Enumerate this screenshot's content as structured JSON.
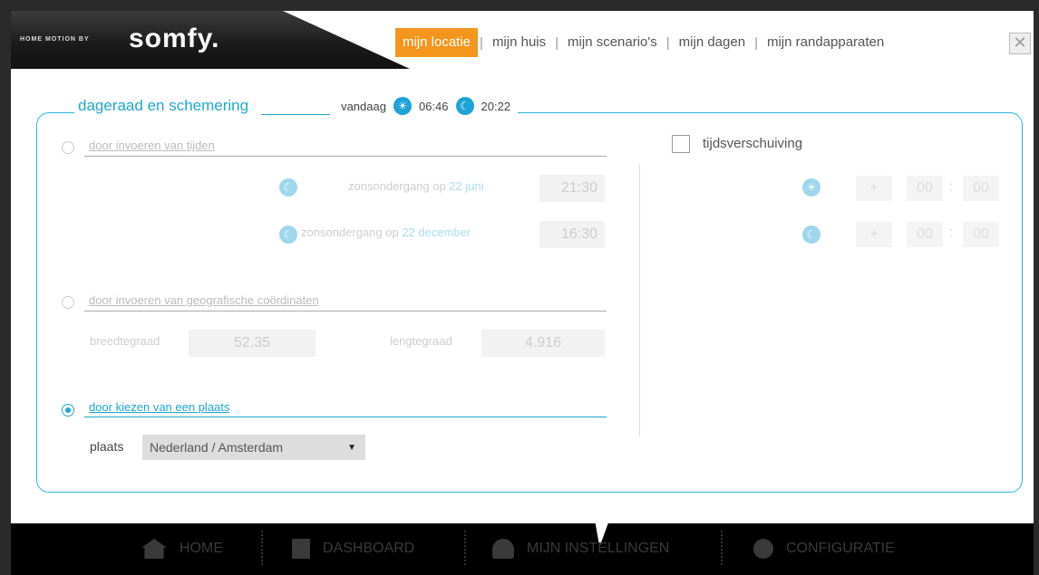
{
  "brand": {
    "small": "HOME MOTION BY",
    "logo": "somfy."
  },
  "tabs": [
    {
      "label": "mijn locatie",
      "active": true
    },
    {
      "label": "mijn huis"
    },
    {
      "label": "mijn scenario's"
    },
    {
      "label": "mijn dagen"
    },
    {
      "label": "mijn randapparaten"
    }
  ],
  "close_glyph": "✕",
  "section": {
    "title": "dageraad en schemering",
    "today_label": "vandaag",
    "sunrise_time": "06:46",
    "sunset_time": "20:22"
  },
  "options": {
    "times": {
      "label": "door invoeren van tijden",
      "row1_prefix": "zonsondergang op ",
      "row1_date": "22 juni",
      "row1_time": "21:30",
      "row2_prefix": "zonsondergang op ",
      "row2_date": "22 december",
      "row2_time": "16:30"
    },
    "coords": {
      "label": "door invoeren van geografische coördinaten",
      "lat_label": "breedtegraad",
      "lat_value": "52.35",
      "lon_label": "lengtegraad",
      "lon_value": "4.916"
    },
    "place": {
      "label": "door kiezen van een plaats",
      "plaats_label": "plaats",
      "selected": "Nederland / Amsterdam"
    }
  },
  "shift": {
    "label": "tijdsverschuiving",
    "rows": [
      {
        "sign": "+",
        "hours": "00",
        "minutes": "00"
      },
      {
        "sign": "+",
        "hours": "00",
        "minutes": "00"
      }
    ]
  },
  "bottom_nav": [
    {
      "label": "HOME",
      "icon": "house-icon"
    },
    {
      "label": "DASHBOARD",
      "icon": "list-icon"
    },
    {
      "label": "MIJN INSTELLINGEN",
      "icon": "user-icon"
    },
    {
      "label": "CONFIGURATIE",
      "icon": "gear-icon"
    }
  ],
  "colors": {
    "accent": "#f4951d",
    "blue": "#1fa7d0"
  }
}
